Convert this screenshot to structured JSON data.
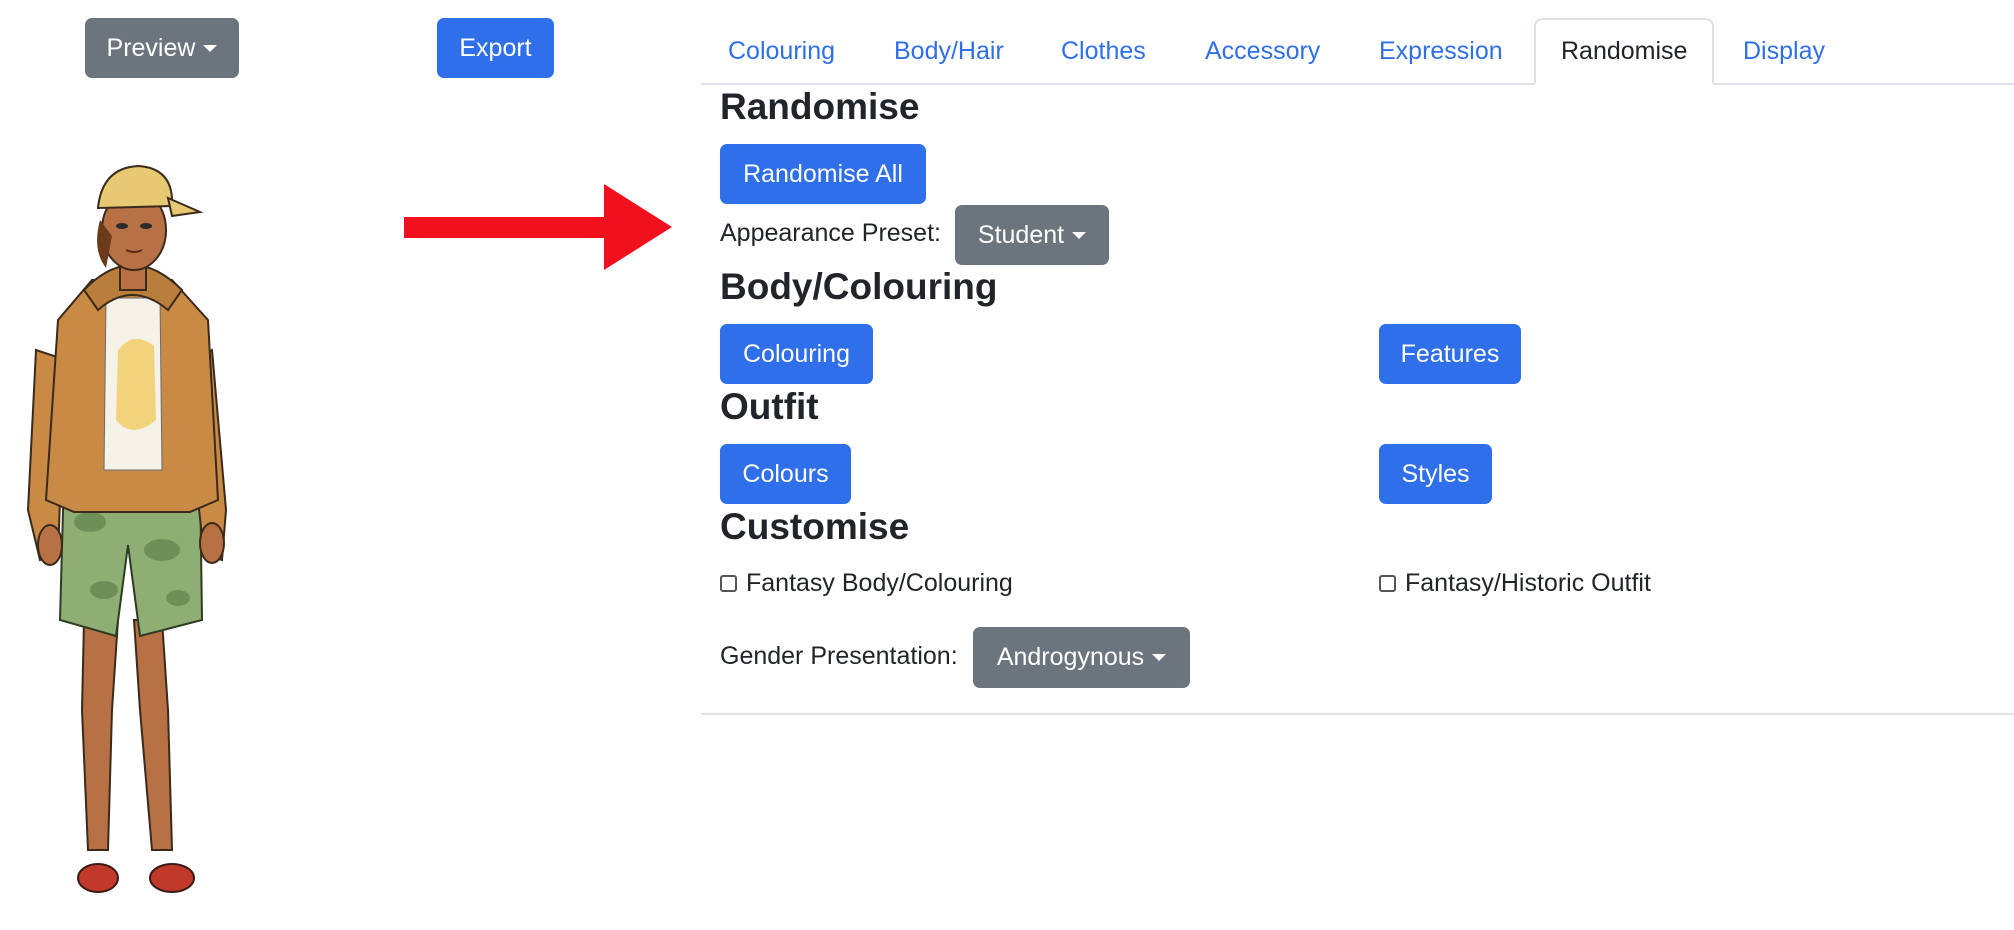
{
  "toolbar": {
    "preview_label": "Preview",
    "export_label": "Export"
  },
  "tabs": [
    {
      "label": "Colouring",
      "active": false
    },
    {
      "label": "Body/Hair",
      "active": false
    },
    {
      "label": "Clothes",
      "active": false
    },
    {
      "label": "Accessory",
      "active": false
    },
    {
      "label": "Expression",
      "active": false
    },
    {
      "label": "Randomise",
      "active": true
    },
    {
      "label": "Display",
      "active": false
    }
  ],
  "randomise": {
    "heading": "Randomise",
    "randomise_all_label": "Randomise All",
    "preset_label": "Appearance Preset:",
    "preset_value": "Student"
  },
  "body_colouring": {
    "heading": "Body/Colouring",
    "colouring_label": "Colouring",
    "features_label": "Features"
  },
  "outfit": {
    "heading": "Outfit",
    "colours_label": "Colours",
    "styles_label": "Styles"
  },
  "customise": {
    "heading": "Customise",
    "fantasy_body_label": "Fantasy Body/Colouring",
    "fantasy_body_checked": false,
    "fantasy_outfit_label": "Fantasy/Historic Outfit",
    "fantasy_outfit_checked": false,
    "gender_label": "Gender Presentation:",
    "gender_value": "Androgynous"
  },
  "colors": {
    "primary": "#2f6fea",
    "secondary": "#6c757d",
    "annotation_arrow": "#f0101e"
  },
  "icons": [
    "caret-down-icon",
    "red-arrow-annotation"
  ]
}
